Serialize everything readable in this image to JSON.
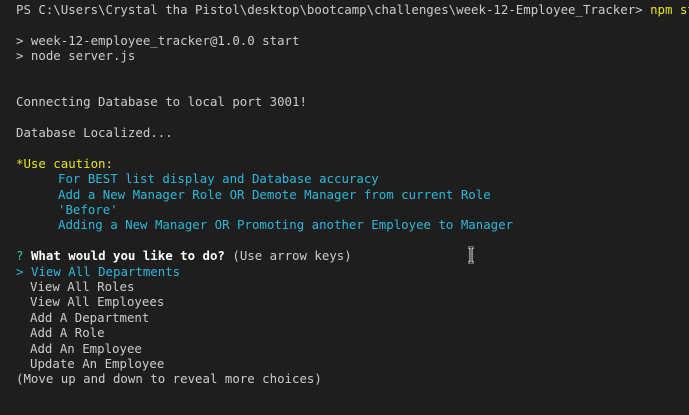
{
  "prompt": {
    "path": "PS C:\\Users\\Crystal tha Pistol\\desktop\\bootcamp\\challenges\\week-12-Employee_Tracker>",
    "command": "npm start"
  },
  "npm": {
    "start_line": "> week-12-employee_tracker@1.0.0 start",
    "node_line": "> node server.js"
  },
  "output": {
    "connecting": "Connecting Database to local port 3001!",
    "localized": "Database Localized..."
  },
  "caution": {
    "heading": "*Use caution:",
    "lines": [
      "For BEST list display and Database accuracy",
      "Add a New Manager Role OR Demote Manager from current Role",
      "'Before'",
      "Adding a New Manager OR Promoting another Employee to Manager"
    ]
  },
  "question": {
    "mark": "?",
    "text": "What would you like to do?",
    "hint": "(Use arrow keys)"
  },
  "menu": {
    "pointer": ">",
    "items": [
      "View All Departments",
      "View All Roles",
      "View All Employees",
      "Add A Department",
      "Add A Role",
      "Add An Employee",
      "Update An Employee"
    ],
    "selected_index": 0,
    "footer": "(Move up and down to reveal more choices)"
  },
  "colors": {
    "background": "#1e1e1e",
    "text": "#cccccc",
    "yellow": "#e5e510",
    "cyan": "#29b8db",
    "green": "#23d18b"
  },
  "icons": {
    "mouse_cursor": "text-cursor-icon"
  }
}
